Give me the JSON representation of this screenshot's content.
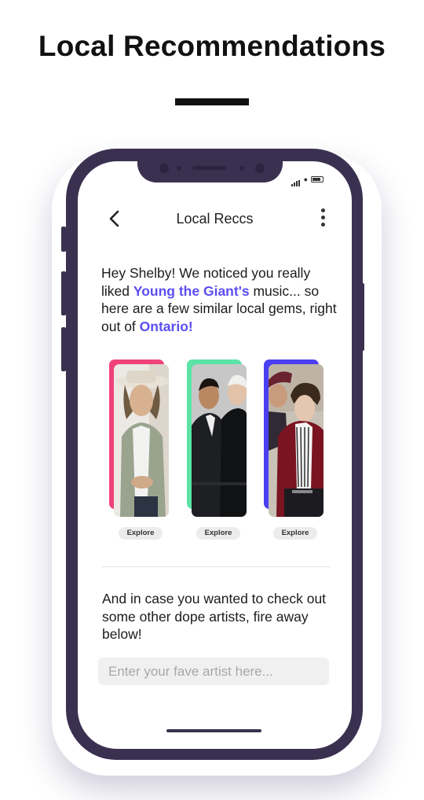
{
  "page": {
    "headline": "Local Recommendations"
  },
  "app": {
    "title": "Local Reccs",
    "intro": {
      "part1": "Hey Shelby! We noticed you really liked ",
      "artist": "Young the Giant's",
      "part2": " music... so here are a few similar local gems, right out of ",
      "region": "Ontario!"
    },
    "artists": [
      {
        "accent": "#f0427a",
        "explore_label": "Explore"
      },
      {
        "accent": "#5be3a6",
        "explore_label": "Explore"
      },
      {
        "accent": "#4a3ff0",
        "explore_label": "Explore"
      }
    ],
    "more_text": "And in case you wanted to check out some other dope artists, fire away below!",
    "search": {
      "placeholder": "Enter your fave artist here...",
      "value": ""
    }
  },
  "colors": {
    "highlight": "#5b4ff0",
    "phone_frame": "#3a3150"
  },
  "icons": {
    "back": "chevron-left-icon",
    "menu": "kebab-menu-icon",
    "signal": "signal-icon",
    "wifi": "wifi-icon",
    "battery": "battery-icon"
  }
}
